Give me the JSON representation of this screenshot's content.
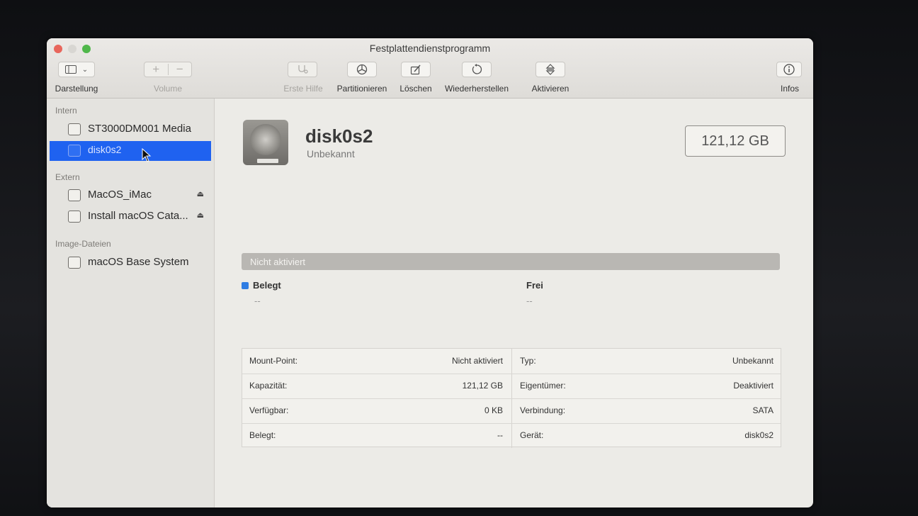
{
  "window": {
    "title": "Festplattendienstprogramm"
  },
  "toolbar": {
    "view_label": "Darstellung",
    "volume_label": "Volume",
    "firstaid_label": "Erste Hilfe",
    "partition_label": "Partitionieren",
    "erase_label": "Löschen",
    "restore_label": "Wiederherstellen",
    "mount_label": "Aktivieren",
    "info_label": "Infos",
    "plus": "+",
    "minus": "−"
  },
  "sidebar": {
    "sections": [
      {
        "title": "Intern"
      },
      {
        "title": "Extern"
      },
      {
        "title": "Image-Dateien"
      }
    ],
    "items": [
      {
        "label": "ST3000DM001 Media"
      },
      {
        "label": "disk0s2"
      },
      {
        "label": "MacOS_iMac"
      },
      {
        "label": "Install macOS Cata..."
      },
      {
        "label": "macOS Base System"
      }
    ],
    "eject": "⏏"
  },
  "volume": {
    "name": "disk0s2",
    "subtitle": "Unbekannt",
    "size": "121,12 GB"
  },
  "usage": {
    "bar_text": "Nicht aktiviert",
    "used_label": "Belegt",
    "used_value": "--",
    "free_label": "Frei",
    "free_value": "--",
    "used_color": "#2f7de3"
  },
  "info": {
    "rows": [
      {
        "k1": "Mount-Point:",
        "v1": "Nicht aktiviert",
        "k2": "Typ:",
        "v2": "Unbekannt"
      },
      {
        "k1": "Kapazität:",
        "v1": "121,12 GB",
        "k2": "Eigentümer:",
        "v2": "Deaktiviert"
      },
      {
        "k1": "Verfügbar:",
        "v1": "0 KB",
        "k2": "Verbindung:",
        "v2": "SATA"
      },
      {
        "k1": "Belegt:",
        "v1": "--",
        "k2": "Gerät:",
        "v2": "disk0s2"
      }
    ]
  }
}
